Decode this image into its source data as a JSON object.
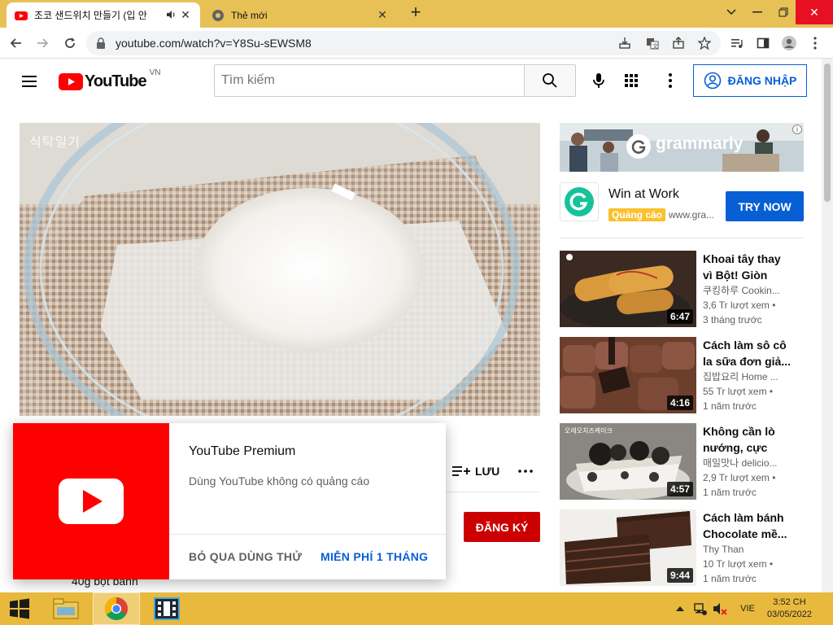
{
  "browser": {
    "tabs": [
      {
        "title": "조코 샌드위치 만들기 (입 안",
        "active": true
      },
      {
        "title": "Thẻ mới",
        "active": false
      }
    ],
    "new_tab_icon": "plus-icon",
    "url": "youtube.com/watch?v=Y8Su-sEWSM8"
  },
  "youtube": {
    "logo_text": "YouTube",
    "region": "VN",
    "search_placeholder": "Tìm kiếm",
    "sign_in": "ĐĂNG NHẬP",
    "video_watermark": "식탁일기"
  },
  "ad": {
    "brand": "grammarly",
    "headline": "Win at Work",
    "badge": "Quảng cáo",
    "domain": "www.gra...",
    "cta": "TRY NOW"
  },
  "related": [
    {
      "title": "Khoai tây thay vì Bột! Giòn và...",
      "channel": "쿠킹하루 Cookin...",
      "views": "3,6 Tr lượt xem •",
      "age": "3 tháng trước",
      "duration": "6:47"
    },
    {
      "title": "Cách làm sô cô la sữa đơn giả...",
      "channel": "집밥요리 Home ...",
      "views": "55 Tr lượt xem •",
      "age": "1 năm trước",
      "duration": "4:16"
    },
    {
      "title": "Không cần lò nướng, cực kỳ...",
      "channel": "매일맛나 delicio...",
      "views": "2,9 Tr lượt xem •",
      "age": "1 năm trước",
      "duration": "4:57"
    },
    {
      "title": "Cách làm bánh Chocolate mề...",
      "channel": "Thy Than",
      "views": "10 Tr lượt xem •",
      "age": "1 năm trước",
      "duration": "9:44"
    }
  ],
  "thumb3_caption": "오레오치즈케이크",
  "actions": {
    "save": "LƯU",
    "subscribe": "ĐĂNG KÝ",
    "description_peek": "40g bột bánh"
  },
  "premium": {
    "title": "YouTube Premium",
    "subtitle": "Dùng YouTube không có quảng cáo",
    "skip": "BỎ QUA DÙNG THỬ",
    "free": "MIỄN PHÍ 1 THÁNG"
  },
  "taskbar": {
    "lang": "VIE",
    "time": "3:52 CH",
    "date": "03/05/2022"
  },
  "colors": {
    "youtube_red": "#ff0000",
    "link_blue": "#065fd4",
    "subscribe_red": "#cc0000",
    "taskbar": "#e8b93c",
    "tabstrip": "#e8c156"
  }
}
